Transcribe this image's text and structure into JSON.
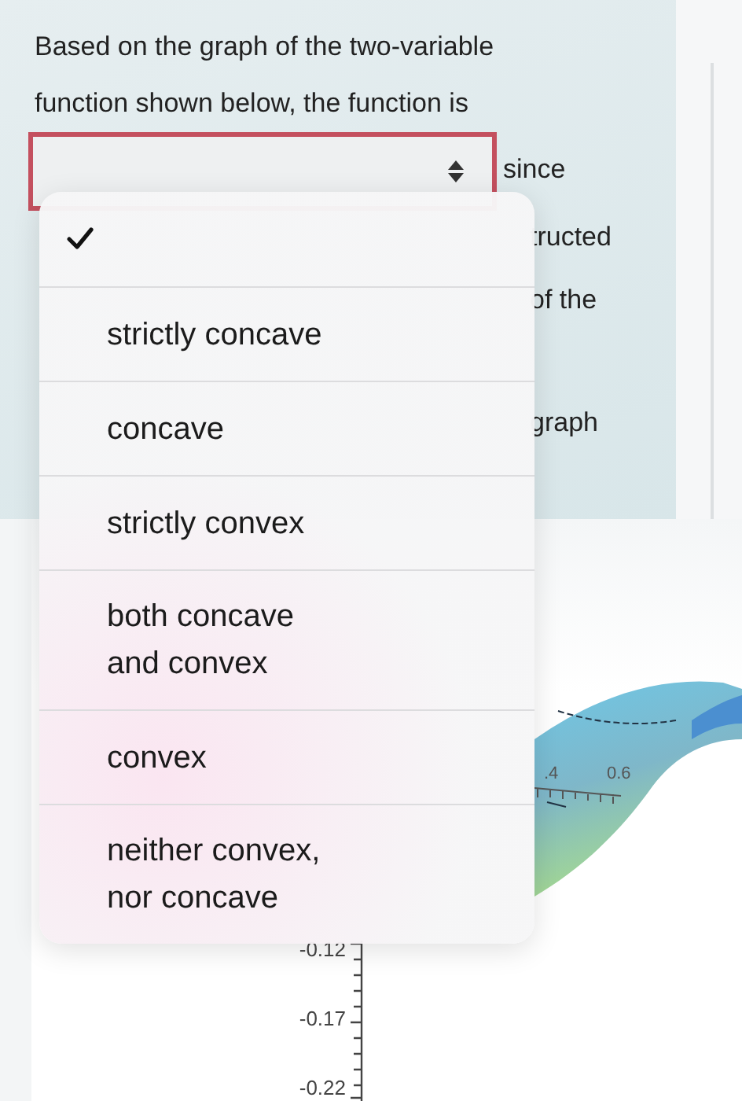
{
  "question": {
    "lines": [
      "Based on the graph of the two-variable",
      "function shown below, the function is"
    ],
    "select": {
      "invalid": true
    },
    "after_select": "since",
    "cut_lines": [
      "tructed",
      "of the",
      "graph"
    ]
  },
  "plot": {
    "x_tick_labels": [
      ".4",
      "0.6"
    ],
    "z_tick_labels": [
      "-0.12",
      "-0.17",
      "-0.22"
    ]
  },
  "dropdown": {
    "options": [
      {
        "selected": true
      },
      {
        "label": "strictly concave",
        "selected": false
      },
      {
        "label": "concave",
        "selected": false
      },
      {
        "label": "strictly convex",
        "selected": false
      },
      {
        "label": "both concave and convex",
        "selected": false
      },
      {
        "label": "convex",
        "selected": false
      },
      {
        "label": "neither convex, nor concave",
        "selected": false
      }
    ]
  }
}
